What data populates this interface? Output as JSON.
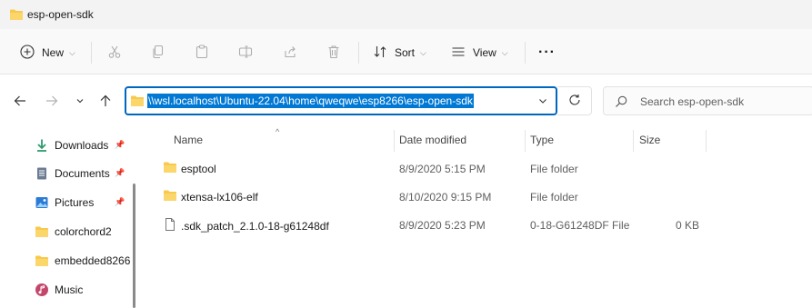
{
  "window": {
    "title": "esp-open-sdk"
  },
  "toolbar": {
    "new_label": "New",
    "sort_label": "Sort",
    "view_label": "View",
    "more_label": "···"
  },
  "address": {
    "path": "\\\\wsl.localhost\\Ubuntu-22.04\\home\\qweqwe\\esp8266\\esp-open-sdk"
  },
  "search": {
    "placeholder": "Search esp-open-sdk"
  },
  "sidebar": {
    "items": [
      {
        "label": "Downloads",
        "icon": "download-icon",
        "pinned": true
      },
      {
        "label": "Documents",
        "icon": "documents-icon",
        "pinned": true
      },
      {
        "label": "Pictures",
        "icon": "pictures-icon",
        "pinned": true
      },
      {
        "label": "colorchord2",
        "icon": "folder-icon",
        "pinned": false
      },
      {
        "label": "embedded8266",
        "icon": "folder-icon",
        "pinned": false
      },
      {
        "label": "Music",
        "icon": "music-icon",
        "pinned": false
      }
    ]
  },
  "columns": {
    "name": "Name",
    "date": "Date modified",
    "type": "Type",
    "size": "Size"
  },
  "files": [
    {
      "name": "esptool",
      "date": "8/9/2020 5:15 PM",
      "type": "File folder",
      "size": "",
      "icon": "folder-icon"
    },
    {
      "name": "xtensa-lx106-elf",
      "date": "8/10/2020 9:15 PM",
      "type": "File folder",
      "size": "",
      "icon": "folder-icon"
    },
    {
      "name": ".sdk_patch_2.1.0-18-g61248df",
      "date": "8/9/2020 5:23 PM",
      "type": "0-18-G61248DF File",
      "size": "0 KB",
      "icon": "file-icon"
    }
  ],
  "colors": {
    "accent": "#0067c0",
    "selection": "#0078d4",
    "folder": "#f8c94a",
    "folder_dark": "#e6a817"
  }
}
